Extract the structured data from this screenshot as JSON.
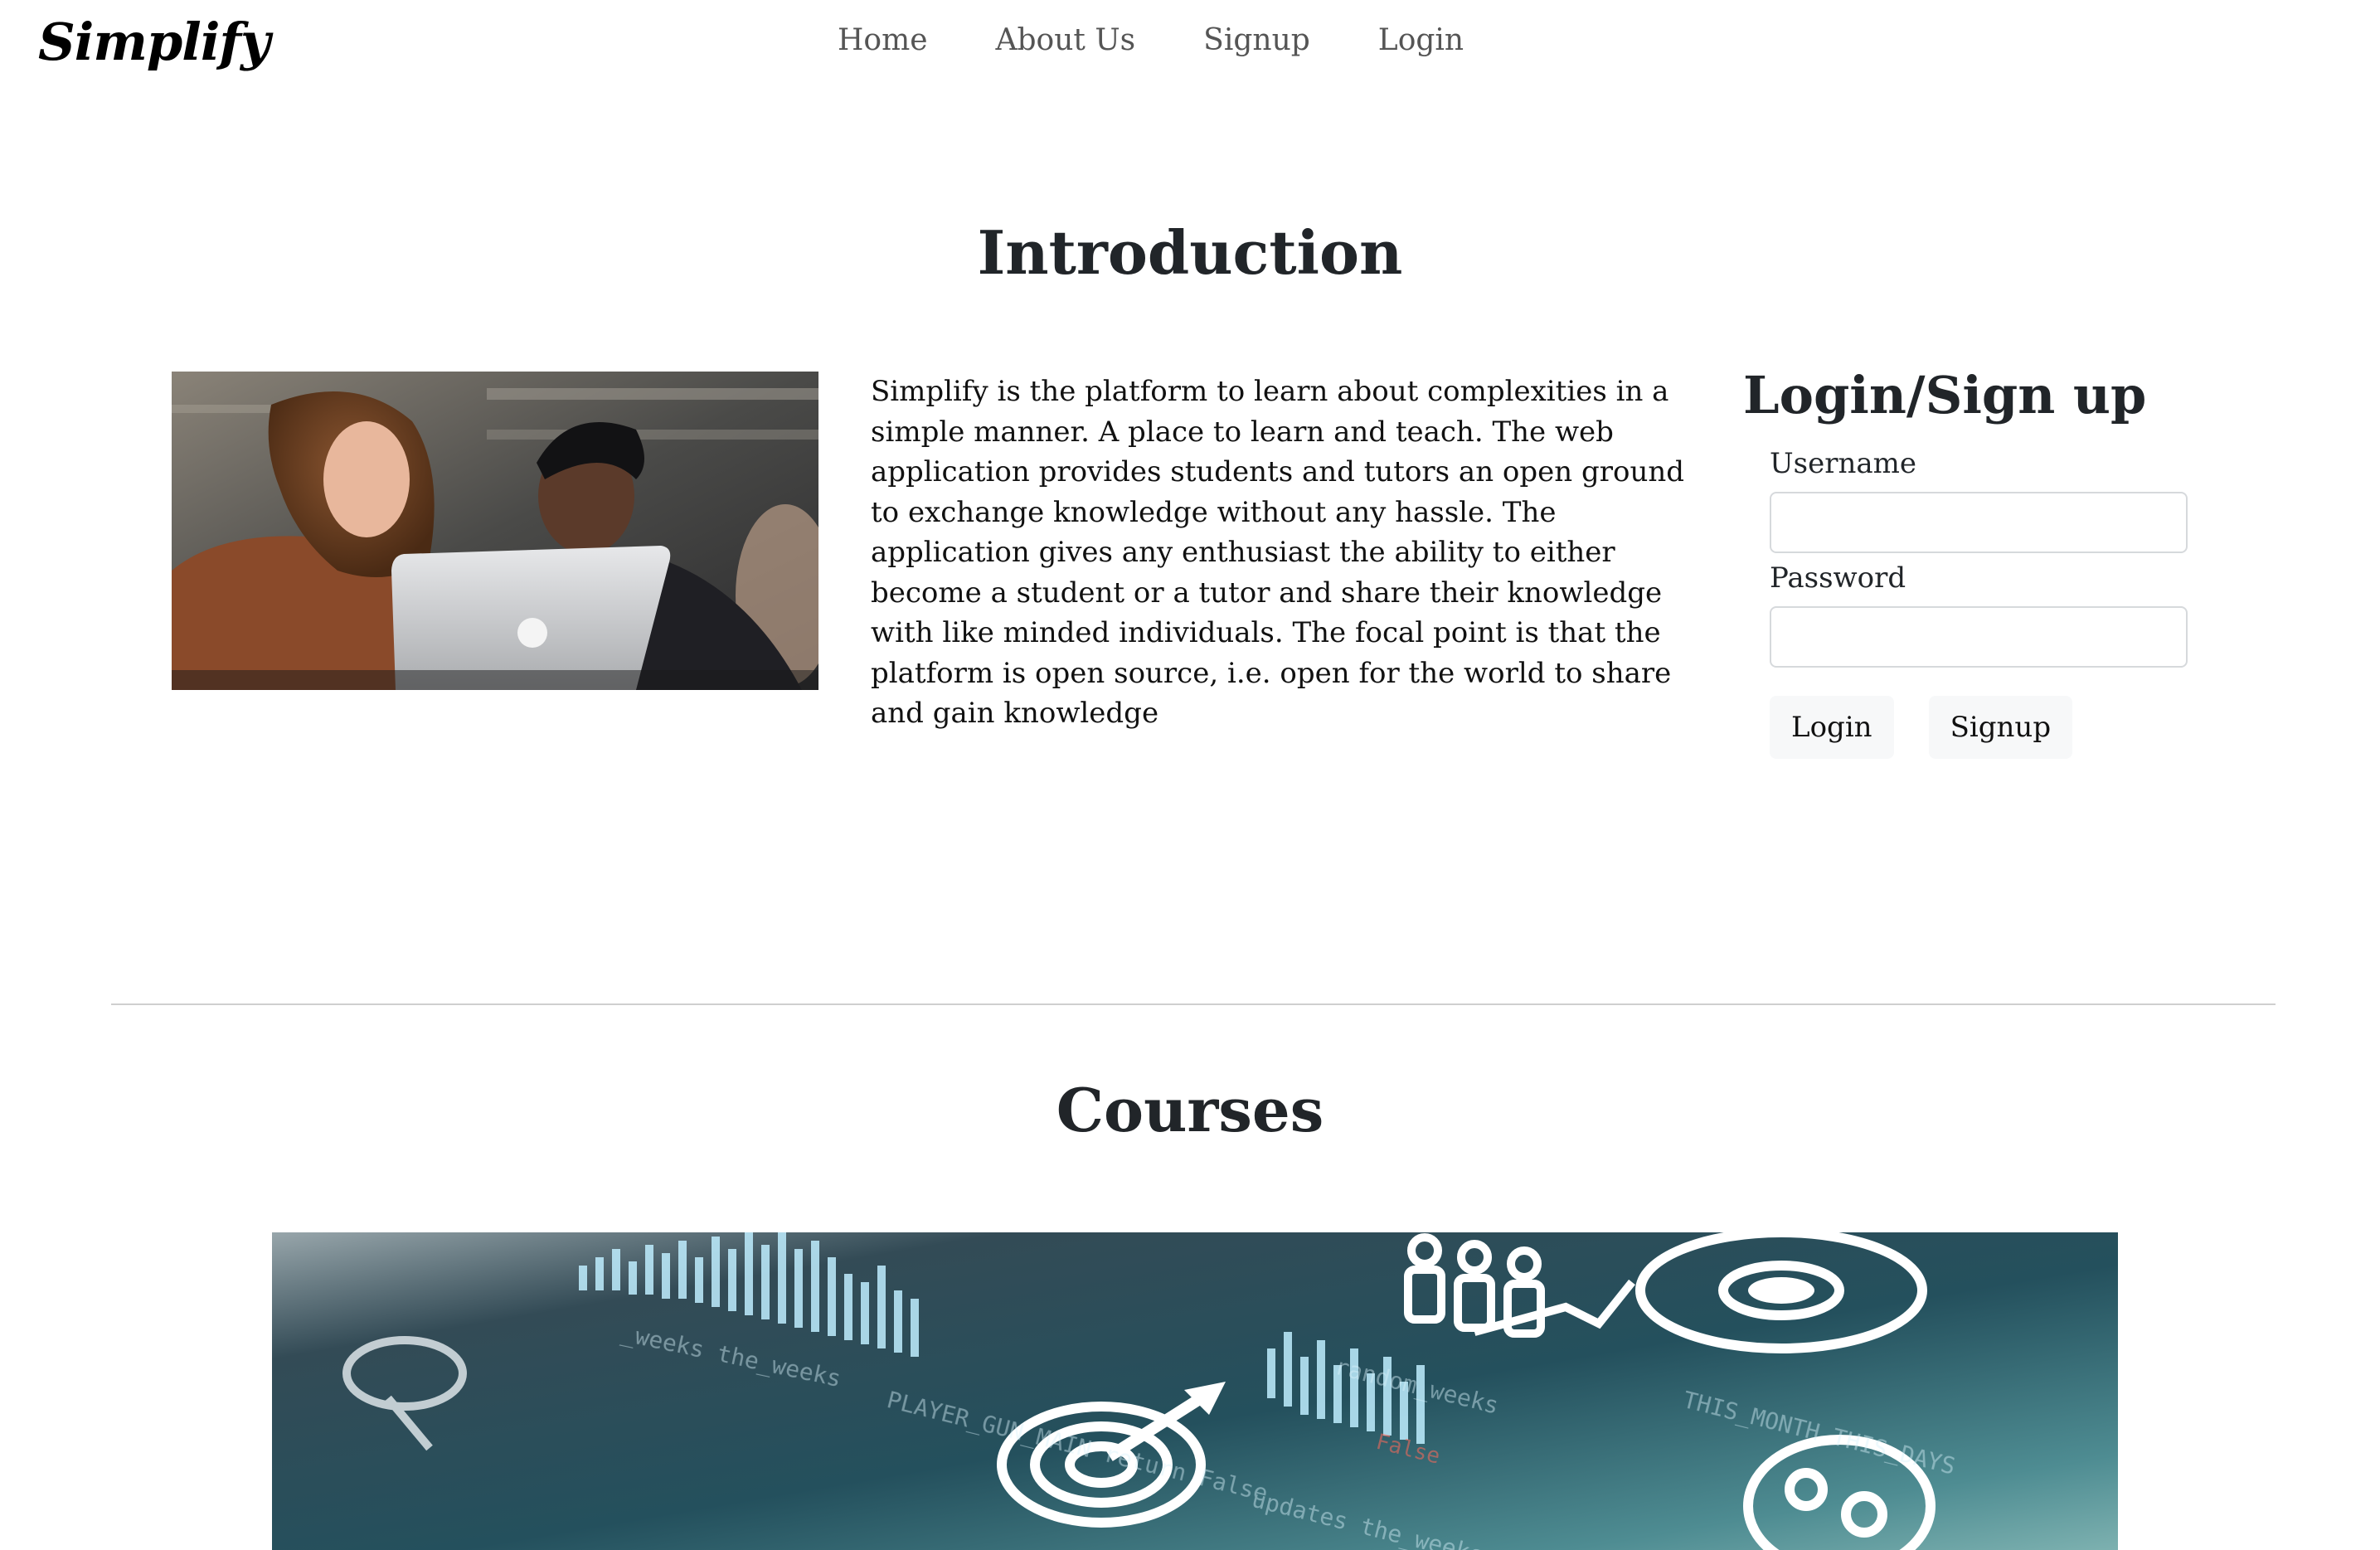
{
  "brand": "Simplify",
  "nav": {
    "items": [
      "Home",
      "About Us",
      "Signup",
      "Login"
    ]
  },
  "intro": {
    "title": "Introduction",
    "image_alt": "two students looking at a laptop",
    "text": "Simplify is the platform to learn about complexities in a simple manner. A place to learn and teach. The web application provides students and tutors an open ground to exchange knowledge without any hassle. The application gives any enthusiast the ability to either become a student or a tutor and share their knowledge with like minded individuals. The focal point is that the platform is open source, i.e. open for the world to share and gain knowledge"
  },
  "login": {
    "title": "Login/Sign up",
    "username_label": "Username",
    "username_value": "",
    "password_label": "Password",
    "password_value": "",
    "login_button": "Login",
    "signup_button": "Signup"
  },
  "courses": {
    "title": "Courses",
    "banner_alt": "abstract data analytics banner with charts, targets and code"
  },
  "colors": {
    "text": "#212529",
    "nav_text": "#555555",
    "divider": "#cfcfcf",
    "button_bg": "#f7f8f9",
    "input_border": "#d6d9dc"
  }
}
